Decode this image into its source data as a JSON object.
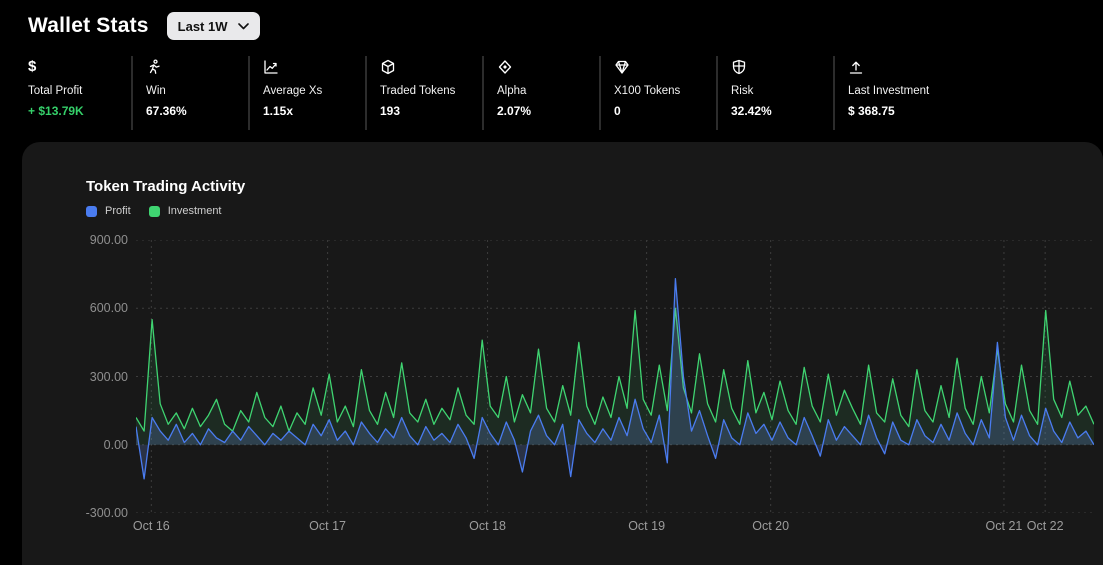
{
  "header": {
    "title": "Wallet Stats",
    "range_selector": {
      "value": "Last 1W"
    }
  },
  "stats": [
    {
      "icon": "dollar-icon",
      "label": "Total Profit",
      "value": "+ $13.79K",
      "value_color": "#35d06a"
    },
    {
      "icon": "runner-icon",
      "label": "Win",
      "value": "67.36%"
    },
    {
      "icon": "chart-growth-icon",
      "label": "Average Xs",
      "value": "1.15x"
    },
    {
      "icon": "cube-icon",
      "label": "Traded Tokens",
      "value": "193"
    },
    {
      "icon": "diamond-icon",
      "label": "Alpha",
      "value": "2.07%"
    },
    {
      "icon": "gem-icon",
      "label": "X100 Tokens",
      "value": "0"
    },
    {
      "icon": "shield-icon",
      "label": "Risk",
      "value": "32.42%"
    },
    {
      "icon": "arrow-up-icon",
      "label": "Last Investment",
      "value": "$ 368.75"
    }
  ],
  "chart_card": {
    "title": "Token Trading Activity",
    "legend": [
      {
        "label": "Profit",
        "color": "#4a7cf0"
      },
      {
        "label": "Investment",
        "color": "#3fd471"
      }
    ]
  },
  "colors": {
    "page_bg": "#000000",
    "card_bg": "#181818",
    "grid": "#3d3d3d",
    "profit_line": "#4a7cf0",
    "investment_line": "#3fd471",
    "positive_value": "#35d06a"
  },
  "chart_data": {
    "type": "line",
    "title": "Token Trading Activity",
    "x_tick_labels": [
      "Oct 16",
      "Oct 17",
      "Oct 18",
      "Oct 19",
      "Oct 20",
      "Oct 21",
      "Oct 22"
    ],
    "x_tick_fracs": [
      0.016,
      0.2,
      0.367,
      0.533,
      0.6625,
      0.906,
      0.949
    ],
    "y_ticks": [
      900,
      600,
      300,
      0,
      -300
    ],
    "y_tick_labels": [
      "900.00",
      "600.00",
      "300.00",
      "0.00",
      "-300.00"
    ],
    "ylim": [
      -300,
      900
    ],
    "grid": "dotted",
    "legend_position": "top-left",
    "series": [
      {
        "name": "Investment",
        "color": "#3fd471",
        "fill": "rgba(80,220,130,0.10)",
        "values": [
          120,
          60,
          550,
          180,
          90,
          140,
          70,
          160,
          80,
          130,
          200,
          90,
          60,
          150,
          100,
          230,
          120,
          80,
          170,
          60,
          140,
          90,
          250,
          130,
          310,
          100,
          170,
          80,
          330,
          150,
          90,
          230,
          120,
          360,
          140,
          100,
          200,
          90,
          160,
          110,
          250,
          130,
          90,
          460,
          170,
          120,
          300,
          100,
          220,
          140,
          420,
          160,
          100,
          260,
          130,
          450,
          170,
          90,
          210,
          120,
          300,
          160,
          590,
          200,
          130,
          350,
          150,
          600,
          250,
          140,
          400,
          180,
          100,
          330,
          160,
          90,
          370,
          140,
          230,
          110,
          280,
          150,
          90,
          340,
          170,
          100,
          310,
          130,
          240,
          160,
          90,
          350,
          140,
          100,
          290,
          130,
          80,
          330,
          150,
          100,
          260,
          120,
          380,
          160,
          90,
          300,
          140,
          420,
          180,
          100,
          350,
          150,
          90,
          590,
          200,
          120,
          280,
          130,
          170,
          90
        ]
      },
      {
        "name": "Profit",
        "color": "#4a7cf0",
        "fill": "rgba(110,145,235,0.22)",
        "values": [
          80,
          -150,
          120,
          60,
          20,
          90,
          10,
          50,
          0,
          70,
          30,
          10,
          60,
          20,
          80,
          40,
          0,
          50,
          20,
          60,
          30,
          0,
          90,
          40,
          110,
          20,
          60,
          0,
          100,
          50,
          10,
          70,
          30,
          120,
          40,
          0,
          80,
          20,
          50,
          10,
          90,
          30,
          -60,
          120,
          50,
          0,
          100,
          20,
          -120,
          60,
          130,
          40,
          0,
          90,
          -140,
          110,
          50,
          10,
          70,
          20,
          120,
          40,
          200,
          70,
          10,
          130,
          -80,
          730,
          300,
          60,
          150,
          40,
          -60,
          110,
          30,
          0,
          140,
          50,
          90,
          20,
          100,
          30,
          0,
          120,
          40,
          -50,
          110,
          20,
          80,
          40,
          0,
          130,
          30,
          -40,
          100,
          20,
          0,
          110,
          40,
          10,
          90,
          20,
          140,
          50,
          0,
          110,
          30,
          450,
          120,
          20,
          130,
          40,
          0,
          160,
          60,
          10,
          100,
          30,
          60,
          0
        ]
      }
    ]
  }
}
